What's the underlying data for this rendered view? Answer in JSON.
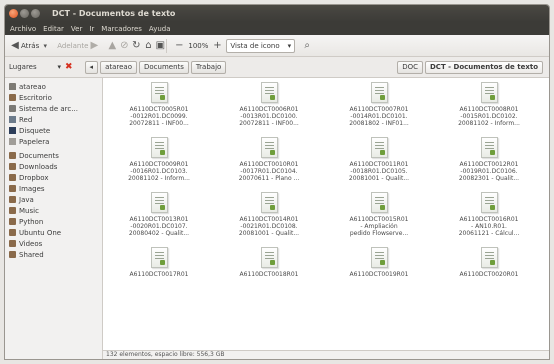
{
  "window": {
    "title": "DCT - Documentos de texto"
  },
  "menu": [
    "Archivo",
    "Editar",
    "Ver",
    "Ir",
    "Marcadores",
    "Ayuda"
  ],
  "toolbar": {
    "back": "Atrás",
    "forward": "Adelante",
    "zoom": "100%",
    "view_mode": "Vista de icono"
  },
  "location": {
    "places_label": "Lugares",
    "crumbs": [
      "atareao",
      "Documents",
      "Trabajo",
      "DOC",
      "DCT - Documentos de texto"
    ]
  },
  "sidebar": {
    "devices": [
      "atareao",
      "Escritorio",
      "Sistema de arc...",
      "Red",
      "Disquete",
      "Papelera"
    ],
    "bookmarks": [
      "Documents",
      "Downloads",
      "Dropbox",
      "Images",
      "Java",
      "Music",
      "Python",
      "Ubuntu One",
      "Videos",
      "Shared"
    ]
  },
  "files": [
    [
      "A6110DCT0005R01",
      "-0012R01.DC0099.",
      "20072811 - INF00..."
    ],
    [
      "A6110DCT0006R01",
      "-0013R01.DC0100.",
      "20072811 - INF00..."
    ],
    [
      "A6110DCT0007R01",
      "-0014R01.DC0101.",
      "20081802 - INF01..."
    ],
    [
      "A6110DCT0008R01",
      "-0015R01.DC0102.",
      "20081102 - Inform..."
    ],
    [
      "A6110DCT0009R01",
      "-0016R01.DC0103.",
      "20081102 - Inform..."
    ],
    [
      "A6110DCT0010R01",
      "-0017R01.DC0104.",
      "20070611 - Plano ..."
    ],
    [
      "A6110DCT0011R01",
      "-0018R01.DC0105.",
      "20081001 - Qualit..."
    ],
    [
      "A6110DCT0012R01",
      "-0019R01.DC0106.",
      "20082301 - Qualit..."
    ],
    [
      "A6110DCT0013R01",
      "-0020R01.DC0107.",
      "20080402 - Qualit..."
    ],
    [
      "A6110DCT0014R01",
      "-0021R01.DC0108.",
      "20081001 - Qualit..."
    ],
    [
      "A6110DCT0015R01",
      "- Ampliación",
      "pedido Flowserve..."
    ],
    [
      "A6110DCT0016R01",
      "- AN10.R01.",
      "20061121 - Cálcul..."
    ],
    [
      "A6110DCT0017R01",
      "",
      ""
    ],
    [
      "A6110DCT0018R01",
      "",
      ""
    ],
    [
      "A6110DCT0019R01",
      "",
      ""
    ],
    [
      "A6110DCT0020R01",
      "",
      ""
    ]
  ],
  "status": "132 elementos, espacio libre: 556,3 GB",
  "icons": {
    "back": "arrow-left-icon",
    "forward": "arrow-right-icon",
    "up": "arrow-up-icon",
    "stop": "stop-icon",
    "reload": "reload-icon",
    "home": "home-icon",
    "computer": "computer-icon",
    "zoom_out": "zoom-out-icon",
    "zoom_in": "zoom-in-icon",
    "search": "search-icon",
    "close_sidebar": "close-x-icon"
  },
  "colors": {
    "titlebar": "#3c3b37",
    "close_button": "#e0521e",
    "close_sidebar_x": "#d6301f"
  }
}
